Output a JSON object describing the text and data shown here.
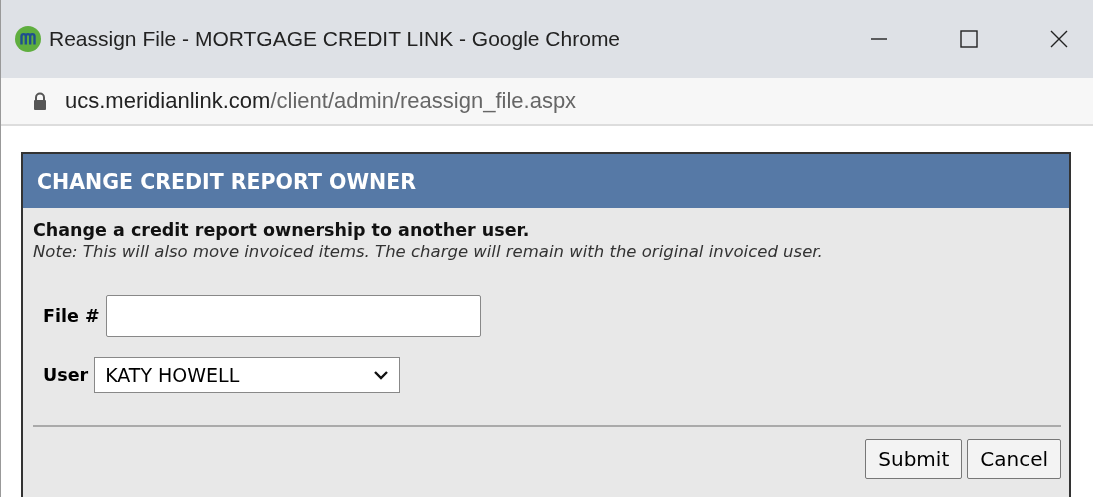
{
  "window": {
    "title": "Reassign File - MORTGAGE CREDIT LINK - Google Chrome"
  },
  "address": {
    "host": "ucs.meridianlink.com",
    "path": "/client/admin/reassign_file.aspx"
  },
  "panel": {
    "title": "CHANGE CREDIT REPORT OWNER",
    "intro": "Change a credit report ownership to another user.",
    "note": "Note: This will also move invoiced items. The charge will remain with the original invoiced user.",
    "fields": [
      {
        "kind": "text",
        "label": "File #"
      },
      {
        "kind": "select",
        "label": "User",
        "value": "KATY HOWELL"
      }
    ],
    "buttons": [
      "Submit",
      "Cancel"
    ]
  }
}
